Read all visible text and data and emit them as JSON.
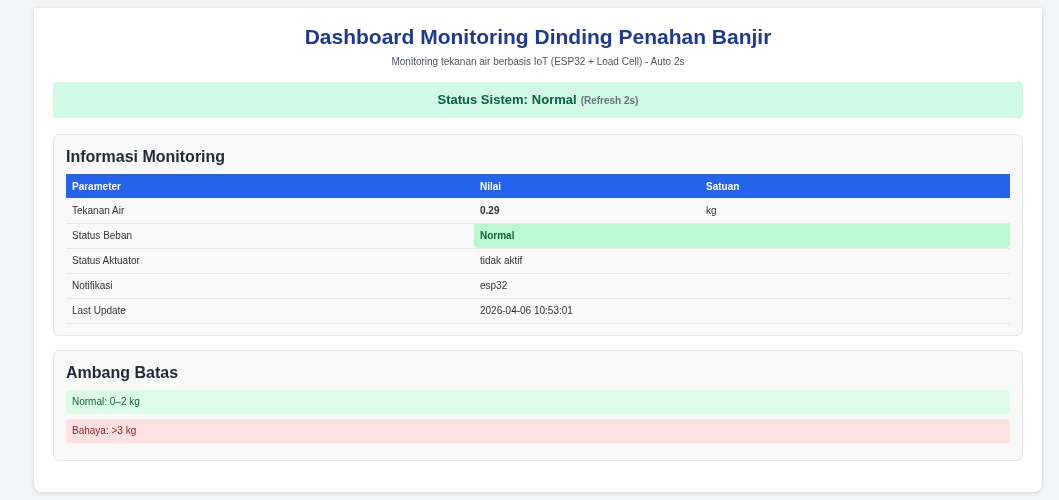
{
  "header": {
    "title": "Dashboard Monitoring Dinding Penahan Banjir",
    "subtitle": "Monitoring tekanan air berbasis IoT (ESP32 + Load Cell) - Auto 2s"
  },
  "status_banner": {
    "kind": "normal",
    "label": "Status Sistem:",
    "value": "Normal",
    "refresh": "(Refresh 2s)"
  },
  "monitoring": {
    "title": "Informasi Monitoring",
    "columns": [
      "Parameter",
      "Nilai",
      "Satuan"
    ],
    "rows": [
      {
        "kind": "bold",
        "cells": [
          "Tekanan Air",
          "0.29",
          "kg"
        ]
      },
      {
        "kind": "status",
        "cells": [
          "Status Beban",
          "Normal",
          ""
        ]
      },
      {
        "kind": "plain",
        "cells": [
          "Status Aktuator",
          "tidak aktif",
          ""
        ]
      },
      {
        "kind": "plain",
        "cells": [
          "Notifikasi",
          "esp32",
          ""
        ]
      },
      {
        "kind": "plain",
        "cells": [
          "Last Update",
          "2026-04-06 10:53:01",
          ""
        ]
      }
    ]
  },
  "thresholds": {
    "title": "Ambang Batas",
    "items": [
      {
        "kind": "normal",
        "text": "Normal: 0–2 kg"
      },
      {
        "kind": "danger",
        "text": "Bahaya: >3 kg"
      }
    ]
  }
}
